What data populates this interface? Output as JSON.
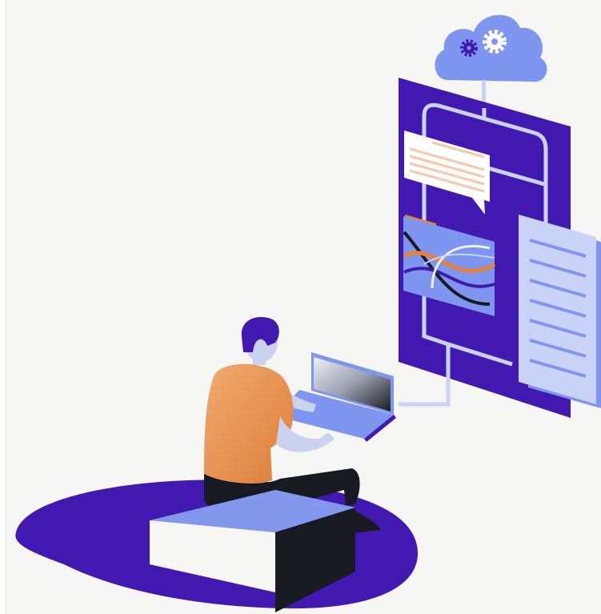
{
  "illustration": {
    "subject": "person-at-laptop-connected-to-cloud-dashboard",
    "icons": [
      "cloud-icon",
      "gear-icon",
      "chat-bubble-icon",
      "chart-icon",
      "document-icon",
      "laptop-icon"
    ],
    "colors": {
      "background": "#f6f6f4",
      "primary_purple": "#4119b0",
      "periwinkle": "#7f96f0",
      "light_lavender": "#c9d3f7",
      "orange": "#e8823a",
      "peach": "#f7c9aa",
      "black": "#171b21",
      "skin": "#c9d2ef"
    }
  }
}
